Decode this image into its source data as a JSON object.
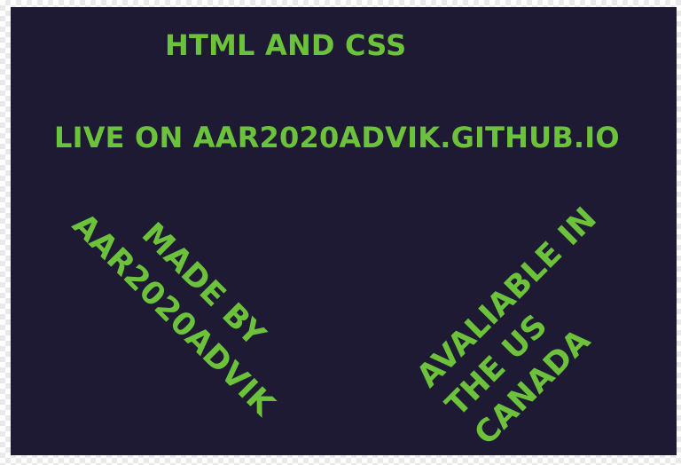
{
  "colors": {
    "background": "#1f1a33",
    "text": "#6cc33b"
  },
  "headline": "HTML AND CSS",
  "live_text": "LIVE ON AAR2020ADVIK.GITHUB.IO",
  "made_by": {
    "line1": "MADE BY",
    "line2": "AAR2020ADVIK"
  },
  "availability": {
    "line1": "AVALIABLE IN",
    "line2": "THE US",
    "line3": "CANADA"
  }
}
